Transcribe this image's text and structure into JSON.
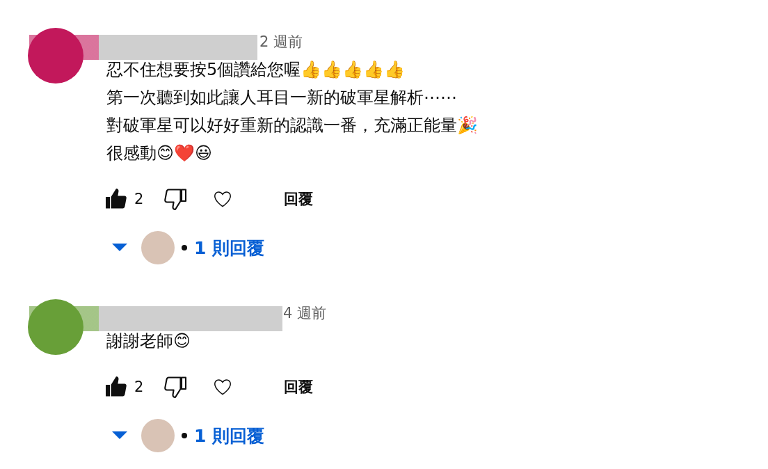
{
  "comments": [
    {
      "color": "#c2185b",
      "time": "2 週前",
      "lines": [
        "忍不住想要按5個讚給您喔👍👍👍👍👍",
        "第一次聽到如此讓人耳目一新的破軍星解析⋯⋯",
        "對破軍星可以好好重新的認識一番，充滿正能量🎉",
        "很感動😊❤️😃"
      ],
      "liked": true,
      "like_count": "2",
      "reply_label": "回覆",
      "replies_link": "1 則回覆"
    },
    {
      "color": "#689f38",
      "time": "4 週前",
      "lines": [
        "謝謝老師😊"
      ],
      "liked": true,
      "like_count": "2",
      "reply_label": "回覆",
      "replies_link": "1 則回覆"
    }
  ]
}
